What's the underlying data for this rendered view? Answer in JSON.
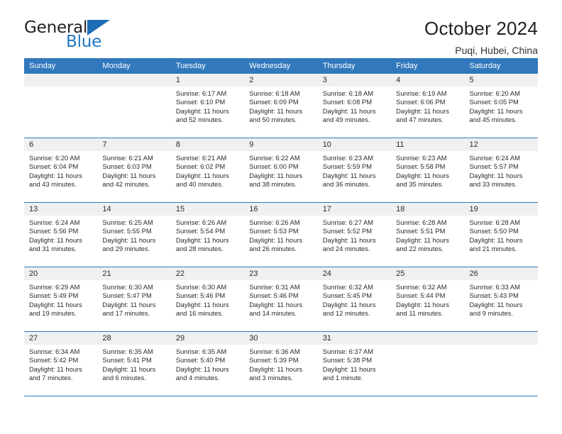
{
  "logo": {
    "word_top": "General",
    "word_bottom": "Blue",
    "accent_color": "#1f6db5"
  },
  "header": {
    "title": "October 2024",
    "subtitle": "Puqi, Hubei, China"
  },
  "theme": {
    "header_bg": "#3179bc",
    "daynum_bg": "#f0f0f0",
    "cell_bg": "#ffffff",
    "grid_line": "#3179bc",
    "text": "#2b2b2b"
  },
  "weekday_headers": [
    "Sunday",
    "Monday",
    "Tuesday",
    "Wednesday",
    "Thursday",
    "Friday",
    "Saturday"
  ],
  "labels": {
    "sunrise_prefix": "Sunrise:",
    "sunset_prefix": "Sunset:",
    "daylight_prefix": "Daylight:"
  },
  "weeks": [
    [
      {
        "day": "",
        "sunrise": "",
        "sunset": "",
        "daylight_line1": "",
        "daylight_line2": ""
      },
      {
        "day": "",
        "sunrise": "",
        "sunset": "",
        "daylight_line1": "",
        "daylight_line2": ""
      },
      {
        "day": "1",
        "sunrise": "Sunrise: 6:17 AM",
        "sunset": "Sunset: 6:10 PM",
        "daylight_line1": "Daylight: 11 hours",
        "daylight_line2": "and 52 minutes."
      },
      {
        "day": "2",
        "sunrise": "Sunrise: 6:18 AM",
        "sunset": "Sunset: 6:09 PM",
        "daylight_line1": "Daylight: 11 hours",
        "daylight_line2": "and 50 minutes."
      },
      {
        "day": "3",
        "sunrise": "Sunrise: 6:18 AM",
        "sunset": "Sunset: 6:08 PM",
        "daylight_line1": "Daylight: 11 hours",
        "daylight_line2": "and 49 minutes."
      },
      {
        "day": "4",
        "sunrise": "Sunrise: 6:19 AM",
        "sunset": "Sunset: 6:06 PM",
        "daylight_line1": "Daylight: 11 hours",
        "daylight_line2": "and 47 minutes."
      },
      {
        "day": "5",
        "sunrise": "Sunrise: 6:20 AM",
        "sunset": "Sunset: 6:05 PM",
        "daylight_line1": "Daylight: 11 hours",
        "daylight_line2": "and 45 minutes."
      }
    ],
    [
      {
        "day": "6",
        "sunrise": "Sunrise: 6:20 AM",
        "sunset": "Sunset: 6:04 PM",
        "daylight_line1": "Daylight: 11 hours",
        "daylight_line2": "and 43 minutes."
      },
      {
        "day": "7",
        "sunrise": "Sunrise: 6:21 AM",
        "sunset": "Sunset: 6:03 PM",
        "daylight_line1": "Daylight: 11 hours",
        "daylight_line2": "and 42 minutes."
      },
      {
        "day": "8",
        "sunrise": "Sunrise: 6:21 AM",
        "sunset": "Sunset: 6:02 PM",
        "daylight_line1": "Daylight: 11 hours",
        "daylight_line2": "and 40 minutes."
      },
      {
        "day": "9",
        "sunrise": "Sunrise: 6:22 AM",
        "sunset": "Sunset: 6:00 PM",
        "daylight_line1": "Daylight: 11 hours",
        "daylight_line2": "and 38 minutes."
      },
      {
        "day": "10",
        "sunrise": "Sunrise: 6:23 AM",
        "sunset": "Sunset: 5:59 PM",
        "daylight_line1": "Daylight: 11 hours",
        "daylight_line2": "and 36 minutes."
      },
      {
        "day": "11",
        "sunrise": "Sunrise: 6:23 AM",
        "sunset": "Sunset: 5:58 PM",
        "daylight_line1": "Daylight: 11 hours",
        "daylight_line2": "and 35 minutes."
      },
      {
        "day": "12",
        "sunrise": "Sunrise: 6:24 AM",
        "sunset": "Sunset: 5:57 PM",
        "daylight_line1": "Daylight: 11 hours",
        "daylight_line2": "and 33 minutes."
      }
    ],
    [
      {
        "day": "13",
        "sunrise": "Sunrise: 6:24 AM",
        "sunset": "Sunset: 5:56 PM",
        "daylight_line1": "Daylight: 11 hours",
        "daylight_line2": "and 31 minutes."
      },
      {
        "day": "14",
        "sunrise": "Sunrise: 6:25 AM",
        "sunset": "Sunset: 5:55 PM",
        "daylight_line1": "Daylight: 11 hours",
        "daylight_line2": "and 29 minutes."
      },
      {
        "day": "15",
        "sunrise": "Sunrise: 6:26 AM",
        "sunset": "Sunset: 5:54 PM",
        "daylight_line1": "Daylight: 11 hours",
        "daylight_line2": "and 28 minutes."
      },
      {
        "day": "16",
        "sunrise": "Sunrise: 6:26 AM",
        "sunset": "Sunset: 5:53 PM",
        "daylight_line1": "Daylight: 11 hours",
        "daylight_line2": "and 26 minutes."
      },
      {
        "day": "17",
        "sunrise": "Sunrise: 6:27 AM",
        "sunset": "Sunset: 5:52 PM",
        "daylight_line1": "Daylight: 11 hours",
        "daylight_line2": "and 24 minutes."
      },
      {
        "day": "18",
        "sunrise": "Sunrise: 6:28 AM",
        "sunset": "Sunset: 5:51 PM",
        "daylight_line1": "Daylight: 11 hours",
        "daylight_line2": "and 22 minutes."
      },
      {
        "day": "19",
        "sunrise": "Sunrise: 6:28 AM",
        "sunset": "Sunset: 5:50 PM",
        "daylight_line1": "Daylight: 11 hours",
        "daylight_line2": "and 21 minutes."
      }
    ],
    [
      {
        "day": "20",
        "sunrise": "Sunrise: 6:29 AM",
        "sunset": "Sunset: 5:49 PM",
        "daylight_line1": "Daylight: 11 hours",
        "daylight_line2": "and 19 minutes."
      },
      {
        "day": "21",
        "sunrise": "Sunrise: 6:30 AM",
        "sunset": "Sunset: 5:47 PM",
        "daylight_line1": "Daylight: 11 hours",
        "daylight_line2": "and 17 minutes."
      },
      {
        "day": "22",
        "sunrise": "Sunrise: 6:30 AM",
        "sunset": "Sunset: 5:46 PM",
        "daylight_line1": "Daylight: 11 hours",
        "daylight_line2": "and 16 minutes."
      },
      {
        "day": "23",
        "sunrise": "Sunrise: 6:31 AM",
        "sunset": "Sunset: 5:46 PM",
        "daylight_line1": "Daylight: 11 hours",
        "daylight_line2": "and 14 minutes."
      },
      {
        "day": "24",
        "sunrise": "Sunrise: 6:32 AM",
        "sunset": "Sunset: 5:45 PM",
        "daylight_line1": "Daylight: 11 hours",
        "daylight_line2": "and 12 minutes."
      },
      {
        "day": "25",
        "sunrise": "Sunrise: 6:32 AM",
        "sunset": "Sunset: 5:44 PM",
        "daylight_line1": "Daylight: 11 hours",
        "daylight_line2": "and 11 minutes."
      },
      {
        "day": "26",
        "sunrise": "Sunrise: 6:33 AM",
        "sunset": "Sunset: 5:43 PM",
        "daylight_line1": "Daylight: 11 hours",
        "daylight_line2": "and 9 minutes."
      }
    ],
    [
      {
        "day": "27",
        "sunrise": "Sunrise: 6:34 AM",
        "sunset": "Sunset: 5:42 PM",
        "daylight_line1": "Daylight: 11 hours",
        "daylight_line2": "and 7 minutes."
      },
      {
        "day": "28",
        "sunrise": "Sunrise: 6:35 AM",
        "sunset": "Sunset: 5:41 PM",
        "daylight_line1": "Daylight: 11 hours",
        "daylight_line2": "and 6 minutes."
      },
      {
        "day": "29",
        "sunrise": "Sunrise: 6:35 AM",
        "sunset": "Sunset: 5:40 PM",
        "daylight_line1": "Daylight: 11 hours",
        "daylight_line2": "and 4 minutes."
      },
      {
        "day": "30",
        "sunrise": "Sunrise: 6:36 AM",
        "sunset": "Sunset: 5:39 PM",
        "daylight_line1": "Daylight: 11 hours",
        "daylight_line2": "and 3 minutes."
      },
      {
        "day": "31",
        "sunrise": "Sunrise: 6:37 AM",
        "sunset": "Sunset: 5:38 PM",
        "daylight_line1": "Daylight: 11 hours",
        "daylight_line2": "and 1 minute."
      },
      {
        "day": "",
        "sunrise": "",
        "sunset": "",
        "daylight_line1": "",
        "daylight_line2": ""
      },
      {
        "day": "",
        "sunrise": "",
        "sunset": "",
        "daylight_line1": "",
        "daylight_line2": ""
      }
    ]
  ]
}
